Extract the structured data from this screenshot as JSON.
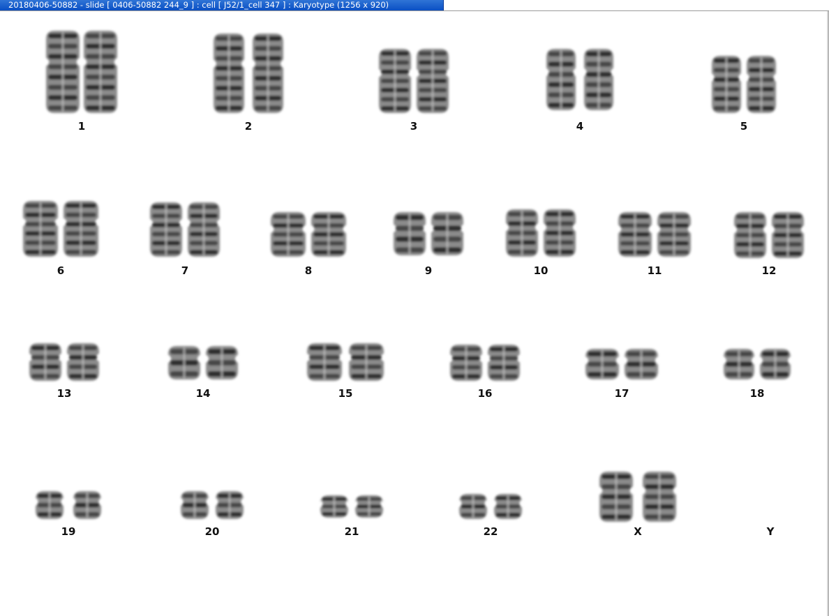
{
  "window": {
    "title": "20180406-50882 - slide [ 0406-50882 244_9 ] : cell [ J52/1_cell 347 ] : Karyotype  (1256 x 920)"
  },
  "karyotype": {
    "pairs": [
      {
        "id": "1",
        "label": "1",
        "count": 2
      },
      {
        "id": "2",
        "label": "2",
        "count": 2
      },
      {
        "id": "3",
        "label": "3",
        "count": 2
      },
      {
        "id": "4",
        "label": "4",
        "count": 2
      },
      {
        "id": "5",
        "label": "5",
        "count": 2
      },
      {
        "id": "6",
        "label": "6",
        "count": 2
      },
      {
        "id": "7",
        "label": "7",
        "count": 2
      },
      {
        "id": "8",
        "label": "8",
        "count": 2
      },
      {
        "id": "9",
        "label": "9",
        "count": 2
      },
      {
        "id": "10",
        "label": "10",
        "count": 2
      },
      {
        "id": "11",
        "label": "11",
        "count": 2
      },
      {
        "id": "12",
        "label": "12",
        "count": 2
      },
      {
        "id": "13",
        "label": "13",
        "count": 2
      },
      {
        "id": "14",
        "label": "14",
        "count": 2
      },
      {
        "id": "15",
        "label": "15",
        "count": 2
      },
      {
        "id": "16",
        "label": "16",
        "count": 2
      },
      {
        "id": "17",
        "label": "17",
        "count": 2
      },
      {
        "id": "18",
        "label": "18",
        "count": 2
      },
      {
        "id": "19",
        "label": "19",
        "count": 2
      },
      {
        "id": "20",
        "label": "20",
        "count": 2
      },
      {
        "id": "21",
        "label": "21",
        "count": 2
      },
      {
        "id": "22",
        "label": "22",
        "count": 2
      },
      {
        "id": "X",
        "label": "X",
        "count": 2
      },
      {
        "id": "Y",
        "label": "Y",
        "count": 0
      }
    ]
  }
}
